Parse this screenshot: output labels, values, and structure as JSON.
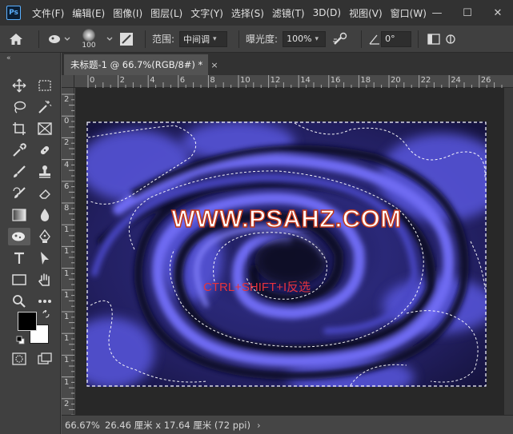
{
  "app": {
    "logo": "Ps"
  },
  "menu": [
    "文件(F)",
    "编辑(E)",
    "图像(I)",
    "图层(L)",
    "文字(Y)",
    "选择(S)",
    "滤镜(T)",
    "3D(D)",
    "视图(V)",
    "窗口(W)"
  ],
  "window_controls": {
    "minimize": "—",
    "maximize": "☐",
    "close": "✕"
  },
  "options": {
    "brush_size": "100",
    "range_label": "范围:",
    "range_value": "中间调",
    "exposure_label": "曝光度:",
    "exposure_value": "100%",
    "angle_value": "0°"
  },
  "document": {
    "tab_title": "未标题-1 @ 66.7%(RGB/8#) *",
    "tab_close": "×"
  },
  "rulers": {
    "top": [
      "0",
      "2",
      "4",
      "6",
      "8",
      "10",
      "12",
      "14",
      "16",
      "18",
      "20",
      "22",
      "24",
      "26"
    ],
    "left": [
      "2",
      "0",
      "2",
      "4",
      "6",
      "8",
      "1",
      "1",
      "1",
      "1",
      "1",
      "1",
      "1",
      "1",
      "2"
    ]
  },
  "canvas": {
    "watermark": "WWW.PSAHZ.COM",
    "hint": "CTRL+SHIFT+I反选"
  },
  "status": {
    "zoom": "66.67%",
    "doc_size": "26.46 厘米 x 17.64 厘米 (72 ppi)",
    "arrow": "›"
  },
  "colors": {
    "foreground": "#000000",
    "background": "#ffffff",
    "watermark_stroke": "#c0391e",
    "hint_text": "#e5333d",
    "swirl_light": "#6a67f0",
    "swirl_dark": "#0c0a22"
  },
  "tools": [
    "move-tool",
    "marquee-tool",
    "lasso-tool",
    "magic-wand-tool",
    "crop-tool",
    "frame-tool",
    "eyedropper-tool",
    "healing-brush-tool",
    "brush-tool",
    "stamp-tool",
    "history-brush-tool",
    "eraser-tool",
    "gradient-tool",
    "blur-tool",
    "dodge-tool",
    "pen-tool",
    "type-tool",
    "path-selection-tool",
    "rectangle-tool",
    "hand-tool",
    "zoom-tool",
    "more-tools"
  ]
}
